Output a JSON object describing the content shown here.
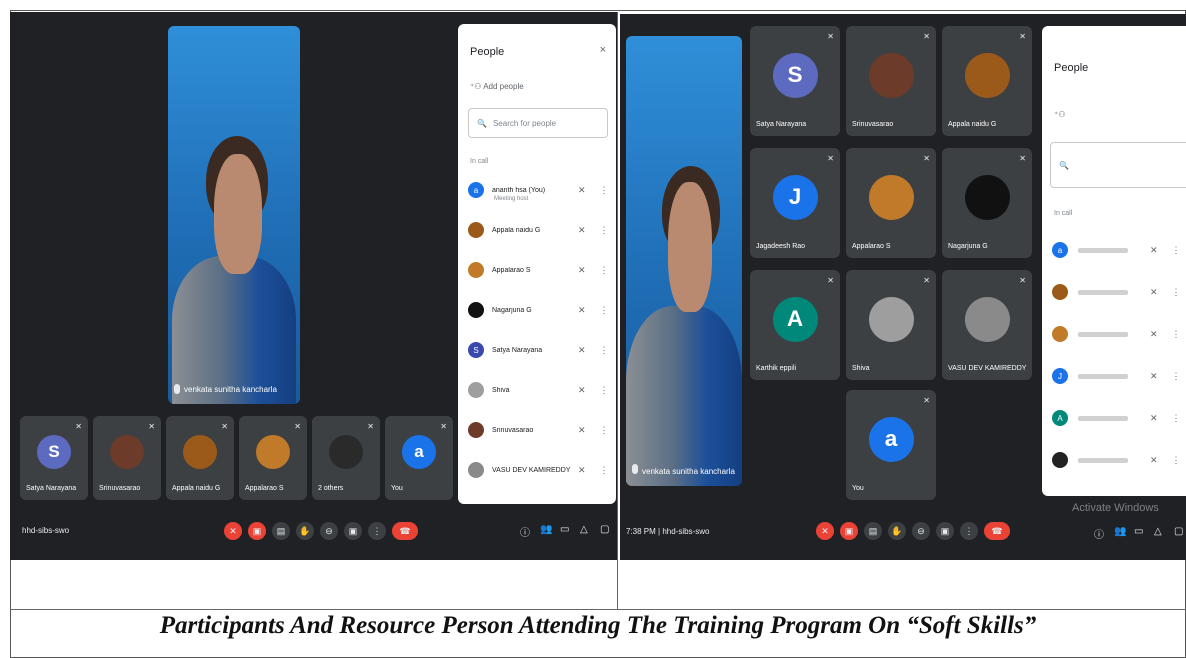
{
  "caption": "Participants And Resource Person Attending The Training Program On “Soft Skills”",
  "left_shot": {
    "speaker_name": "venkata sunitha kancharla",
    "tiles": [
      {
        "name": "Satya Narayana",
        "initial": "S",
        "color": "#5c6bc0"
      },
      {
        "name": "Srinuvasarao",
        "initial": "",
        "color": "#6d3b2a"
      },
      {
        "name": "Appala naidu G",
        "initial": "",
        "color": "#9c5a1a"
      },
      {
        "name": "Appalarao S",
        "initial": "",
        "color": "#c07a2a"
      },
      {
        "name": "2 others",
        "initial": "",
        "color": "#2a2a2a"
      },
      {
        "name": "You",
        "initial": "a",
        "color": "#1a73e8"
      }
    ],
    "meeting_code": "hhd-sibs-swo",
    "panel": {
      "title": "People",
      "close": "×",
      "add_people": "Add people",
      "search_placeholder": "Search for people",
      "section": "In call",
      "people": [
        {
          "name": "ananth hsa (You)",
          "sub": "Meeting host",
          "initial": "a",
          "color": "#1a73e8"
        },
        {
          "name": "Appala naidu G",
          "initial": "",
          "color": "#9c5a1a"
        },
        {
          "name": "Appalarao S",
          "initial": "",
          "color": "#c07a2a"
        },
        {
          "name": "Nagarjuna G",
          "initial": "",
          "color": "#111111"
        },
        {
          "name": "Satya Narayana",
          "initial": "S",
          "color": "#3949ab"
        },
        {
          "name": "Shiva",
          "initial": "",
          "color": "#9e9e9e"
        },
        {
          "name": "Srinuvasarao",
          "initial": "",
          "color": "#6d3b2a"
        },
        {
          "name": "VASU DEV KAMIREDDY",
          "initial": "",
          "color": "#8a8a8a"
        }
      ]
    }
  },
  "right_shot": {
    "speaker_name": "venkata sunitha kancharla",
    "tiles": [
      {
        "name": "Satya Narayana",
        "initial": "S",
        "color": "#5c6bc0"
      },
      {
        "name": "Srinuvasarao",
        "initial": "",
        "color": "#6d3b2a"
      },
      {
        "name": "Appala naidu G",
        "initial": "",
        "color": "#9c5a1a"
      },
      {
        "name": "Jagadeesh Rao",
        "initial": "J",
        "color": "#1a73e8"
      },
      {
        "name": "Appalarao S",
        "initial": "",
        "color": "#c07a2a"
      },
      {
        "name": "Nagarjuna G",
        "initial": "",
        "color": "#111111"
      },
      {
        "name": "Karthik eppili",
        "initial": "A",
        "color": "#00897b"
      },
      {
        "name": "Shiva",
        "initial": "",
        "color": "#9e9e9e"
      },
      {
        "name": "VASU DEV KAMIREDDY",
        "initial": "",
        "color": "#8a8a8a"
      },
      {
        "name": "You",
        "initial": "a",
        "color": "#1a73e8"
      }
    ],
    "time_code": "7:38 PM | hhd-sibs-swo",
    "watermark": "Activate Windows",
    "panel": {
      "title": "People",
      "section": "In call",
      "people": [
        {
          "initial": "a",
          "color": "#1a73e8"
        },
        {
          "initial": "",
          "color": "#9c5a1a"
        },
        {
          "initial": "",
          "color": "#c07a2a"
        },
        {
          "initial": "J",
          "color": "#1a73e8"
        },
        {
          "initial": "A",
          "color": "#00897b"
        },
        {
          "initial": "",
          "color": "#222222"
        }
      ]
    }
  }
}
